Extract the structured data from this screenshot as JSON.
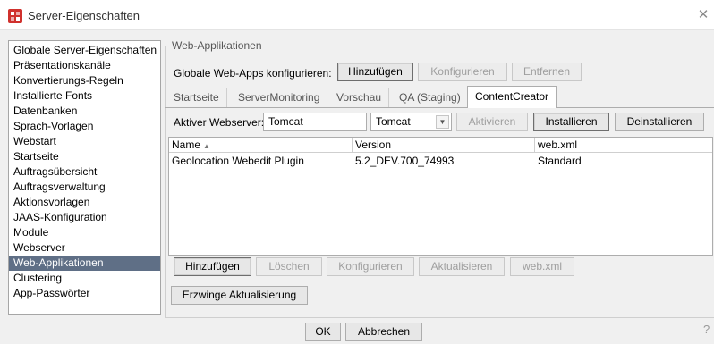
{
  "window": {
    "title": "Server-Eigenschaften"
  },
  "sidebar": {
    "items": [
      {
        "label": "Globale Server-Eigenschaften"
      },
      {
        "label": "Präsentationskanäle"
      },
      {
        "label": "Konvertierungs-Regeln"
      },
      {
        "label": "Installierte Fonts"
      },
      {
        "label": "Datenbanken"
      },
      {
        "label": "Sprach-Vorlagen"
      },
      {
        "label": "Webstart"
      },
      {
        "label": "Startseite"
      },
      {
        "label": "Auftragsübersicht"
      },
      {
        "label": "Auftragsverwaltung"
      },
      {
        "label": "Aktionsvorlagen"
      },
      {
        "label": "JAAS-Konfiguration"
      },
      {
        "label": "Module"
      },
      {
        "label": "Webserver"
      },
      {
        "label": "Web-Applikationen"
      },
      {
        "label": "Clustering"
      },
      {
        "label": "App-Passwörter"
      }
    ],
    "selected": "Web-Applikationen"
  },
  "main": {
    "group_title": "Web-Applikationen",
    "global_label": "Globale Web-Apps konfigurieren:",
    "global_buttons": {
      "add": "Hinzufügen",
      "configure": "Konfigurieren",
      "remove": "Entfernen"
    },
    "tabs": [
      {
        "label": "Startseite"
      },
      {
        "label": "ServerMonitoring"
      },
      {
        "label": "Vorschau"
      },
      {
        "label": "QA (Staging)"
      },
      {
        "label": "ContentCreator"
      }
    ],
    "active_tab": "ContentCreator",
    "webserver_label": "Aktiver Webserver:",
    "webserver_value": "Tomcat",
    "webserver_select": "Tomcat",
    "webserver_buttons": {
      "activate": "Aktivieren",
      "install": "Installieren",
      "uninstall": "Deinstallieren"
    },
    "table": {
      "columns": [
        "Name",
        "Version",
        "web.xml"
      ],
      "rows": [
        [
          "Geolocation Webedit Plugin",
          "5.2_DEV.700_74993",
          "Standard"
        ]
      ]
    },
    "table_buttons": {
      "add": "Hinzufügen",
      "delete": "Löschen",
      "configure": "Konfigurieren",
      "update": "Aktualisieren",
      "webxml": "web.xml"
    },
    "force_update": "Erzwinge Aktualisierung"
  },
  "footer": {
    "ok": "OK",
    "cancel": "Abbrechen",
    "help": "?"
  },
  "colors": {
    "selection": "#5f6f86",
    "app_icon": "#d0312d"
  }
}
